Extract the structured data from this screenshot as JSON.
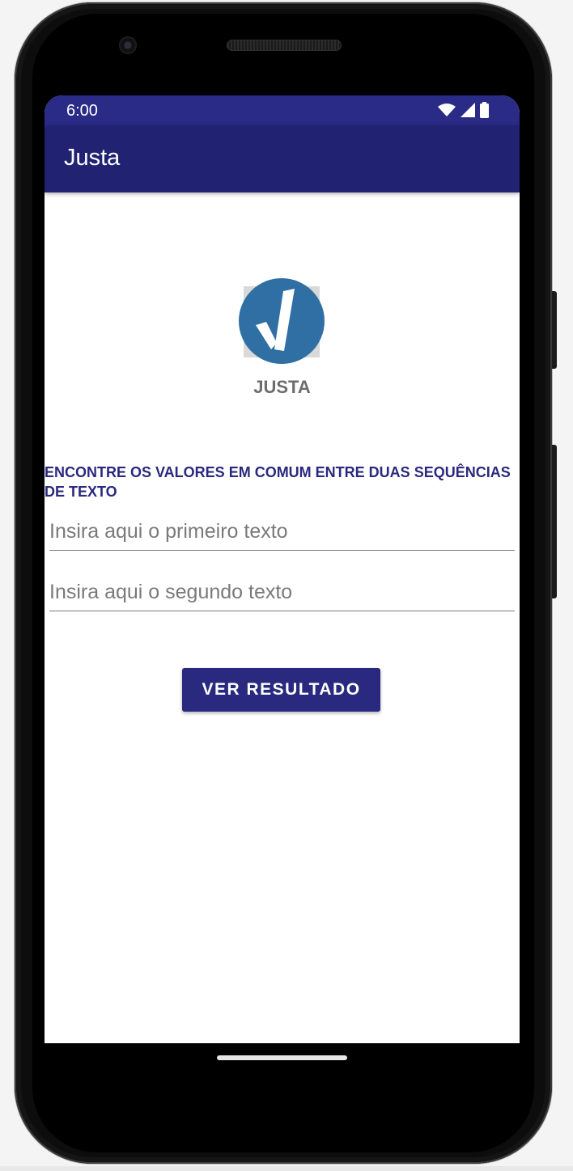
{
  "status_bar": {
    "time": "6:00",
    "icons": [
      "wifi-icon",
      "signal-icon",
      "battery-icon"
    ],
    "color": "#2a2a87"
  },
  "app_bar": {
    "title": "Justa",
    "color": "#212272"
  },
  "logo": {
    "icon": "checkmark-logo-icon",
    "color": "#2f6fa3",
    "name": "JUSTA"
  },
  "main": {
    "headline": "ENCONTRE OS VALORES EM COMUM ENTRE DUAS SEQUÊNCIAS DE TEXTO",
    "first_input": {
      "placeholder": "Insira aqui o primeiro texto",
      "value": ""
    },
    "second_input": {
      "placeholder": "Insira aqui o segundo texto",
      "value": ""
    },
    "button_label": "VER RESULTADO",
    "accent": "#29297f"
  }
}
